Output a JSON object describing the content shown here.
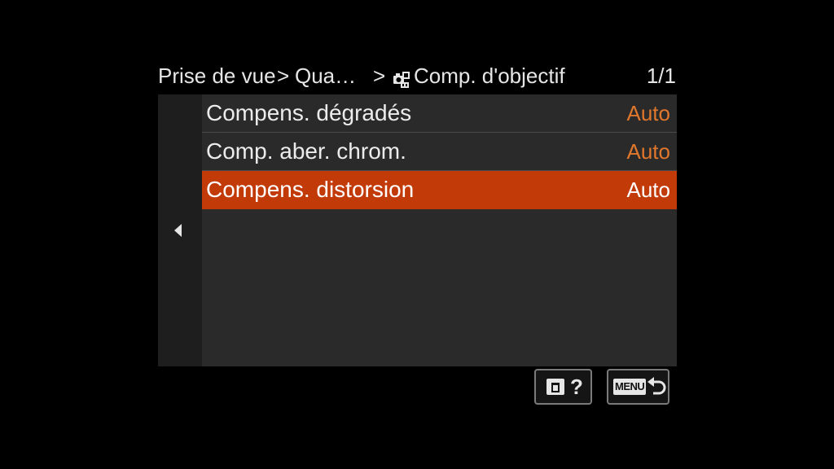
{
  "breadcrumb": {
    "level1": "Prise de vue",
    "sep1": ">",
    "level2": "Qua…",
    "sep2": ">",
    "icon": "camera-settings-icon",
    "level3": "Comp. d'objectif"
  },
  "page_indicator": "1/1",
  "menu": {
    "items": [
      {
        "label": "Compens. dégradés",
        "value": "Auto",
        "selected": false
      },
      {
        "label": "Comp. aber. chrom.",
        "value": "Auto",
        "selected": false
      },
      {
        "label": "Compens. distorsion",
        "value": "Auto",
        "selected": true
      }
    ]
  },
  "buttons": {
    "delete_help": {
      "icon": "trash-icon",
      "label": "?"
    },
    "menu_return": {
      "tag": "MENU",
      "icon": "return-icon"
    }
  },
  "colors": {
    "background": "#000000",
    "panel": "#2a2a2a",
    "selection": "#c33a09",
    "value_accent": "#e0772c",
    "text": "#e6e6e6"
  }
}
